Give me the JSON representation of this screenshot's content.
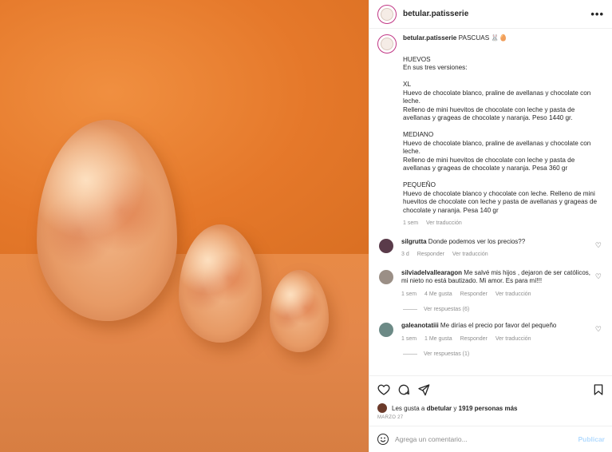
{
  "post": {
    "username": "betular.patisserie",
    "more_label": "•••",
    "caption_user": "betular.patisserie",
    "caption_title": "PASCUAS 🐰🥚",
    "caption_text": "HUEVOS\nEn sus tres versiones:\n\nXL\nHuevo de chocolate blanco, praline de avellanas y chocolate con leche.\nRelleno de mini huevitos de chocolate con leche y pasta de avellanas y grageas de chocolate y naranja. Peso 1440 gr.\n\nMEDIANO\nHuevo de chocolate blanco, praline de avellanas y chocolate con leche.\nRelleno de mini huevitos de chocolate con leche y pasta de avellanas y grageas de chocolate y naranja. Pesa 360 gr\n\nPEQUEÑO\nHuevo de chocolate blanco y chocolate con leche. Relleno de mini huevitos de chocolate con leche y pasta de avellanas y grageas de chocolate y naranja. Pesa 140 gr",
    "caption_time": "1 sem",
    "caption_translate": "Ver traducción"
  },
  "comments": [
    {
      "user": "silgrutta",
      "text": "Donde podemos ver los precios??",
      "time": "3 d",
      "likes": "",
      "reply": "Responder",
      "translate": "Ver traducción",
      "avatar_color": "#5a3b4a",
      "replies": ""
    },
    {
      "user": "silviadelvallearagon",
      "text": "Me salvé mis hijos , dejaron de ser católicos, mi nieto no está bautizado. Mi amor. Es para mí!!!",
      "time": "1 sem",
      "likes": "4 Me gusta",
      "reply": "Responder",
      "translate": "Ver traducción",
      "avatar_color": "#9b8f86",
      "replies": "Ver respuestas (6)"
    },
    {
      "user": "galeanotatiii",
      "text": "Me dirías el precio por favor del pequeño",
      "time": "1 sem",
      "likes": "1 Me gusta",
      "reply": "Responder",
      "translate": "Ver traducción",
      "avatar_color": "#6c8a86",
      "replies": "Ver respuestas (1)"
    }
  ],
  "likes": {
    "prefix": "Les gusta a",
    "user": "dbetular",
    "connector": "y",
    "others": "1919 personas más"
  },
  "date": "MARZO 27",
  "add_comment": {
    "placeholder": "Agrega un comentario...",
    "post_label": "Publicar"
  },
  "colors": {
    "background": "#e5823a",
    "ring": "#c13584",
    "post_button": "#b3dbff"
  }
}
